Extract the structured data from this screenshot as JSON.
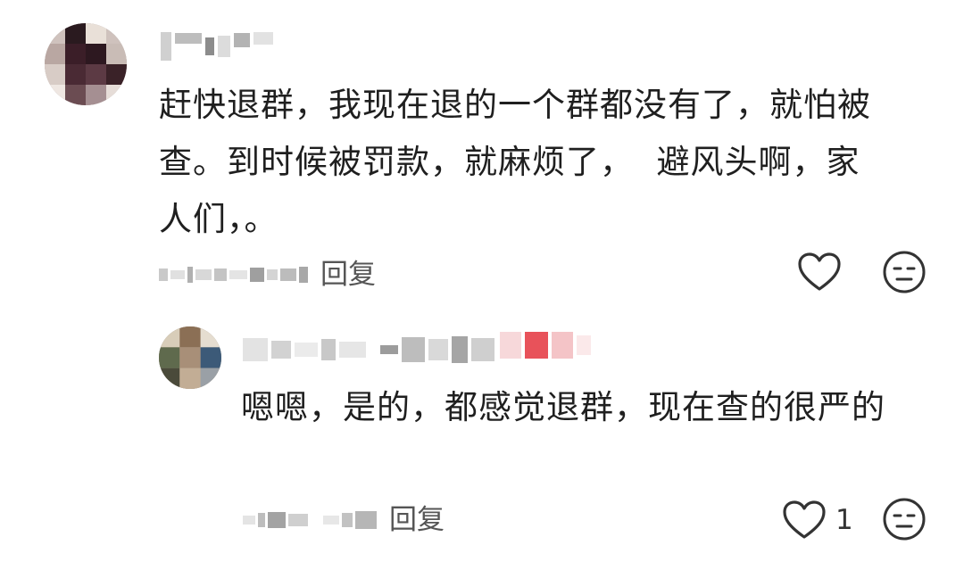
{
  "main_comment": {
    "avatar": "blurred-avatar",
    "username": "",
    "text": "赶快退群，我现在退的一个群都没有了，就怕被查。到时候被罚款，就麻烦了，  避风头啊，家人们，。",
    "reply_label": "回复",
    "like_icon": "heart-outline-icon",
    "dislike_icon": "neutral-face-icon"
  },
  "reply_comment": {
    "avatar": "blurred-avatar",
    "username": "",
    "text": "嗯嗯，是的，都感觉退群，现在查的很严的",
    "reply_label": "回复",
    "like_count": "1",
    "like_icon": "heart-outline-icon",
    "dislike_icon": "neutral-face-icon"
  },
  "colors": {
    "text": "#1f1f1f",
    "secondary": "#555555",
    "icon": "#333333",
    "badge_red": "#e8525a"
  }
}
